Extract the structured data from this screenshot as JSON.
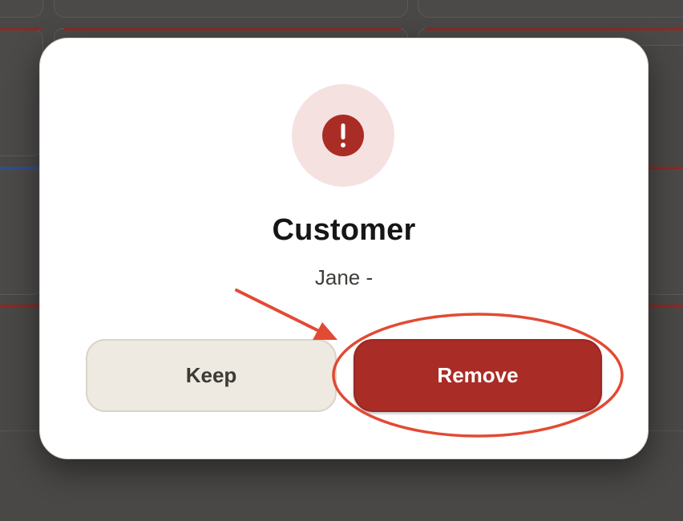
{
  "dialog": {
    "icon": "alert-circle-icon",
    "title": "Customer",
    "subtitle": "Jane -",
    "keep_label": "Keep",
    "remove_label": "Remove"
  },
  "annotation": {
    "arrow_color": "#e24a33",
    "ellipse_color": "#e24a33"
  },
  "colors": {
    "danger": "#aa2c26",
    "danger_soft": "#f6e1e1",
    "neutral_button": "#eeeae1",
    "backdrop": "#4a4846"
  }
}
